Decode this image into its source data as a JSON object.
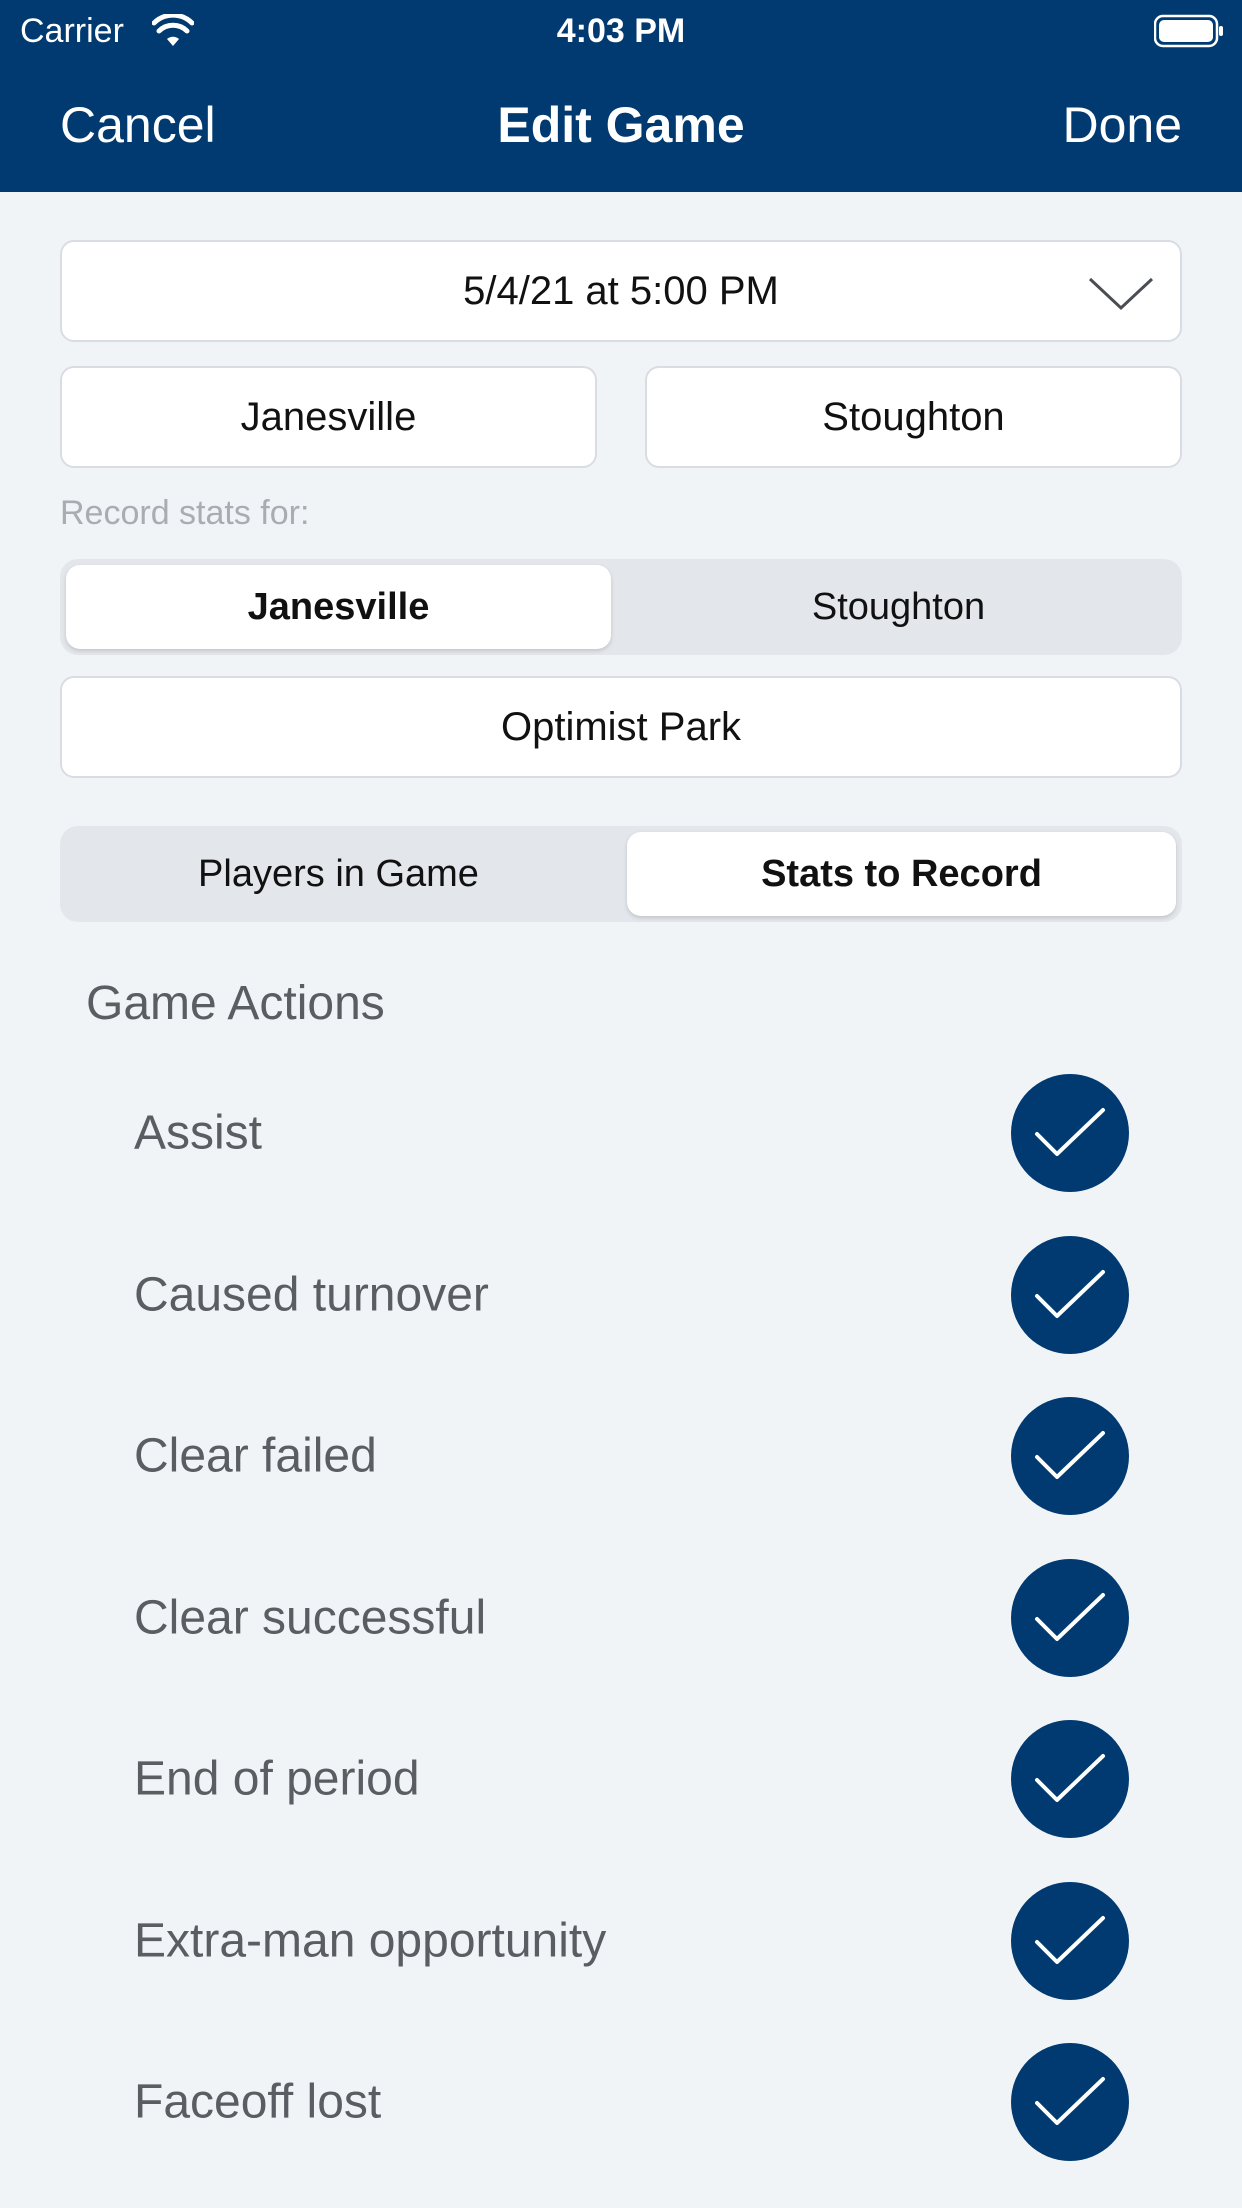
{
  "status_bar": {
    "carrier": "Carrier",
    "time": "4:03 PM"
  },
  "nav": {
    "cancel": "Cancel",
    "title": "Edit Game",
    "done": "Done"
  },
  "date_picker": {
    "value": "5/4/21 at 5:00 PM"
  },
  "teams": {
    "home": "Janesville",
    "away": "Stoughton"
  },
  "record_stats": {
    "label": "Record stats for:",
    "options": [
      "Janesville",
      "Stoughton"
    ],
    "selected": "Janesville"
  },
  "location": {
    "value": "Optimist Park"
  },
  "view_tabs": {
    "options": [
      "Players in Game",
      "Stats to Record"
    ],
    "selected": "Stats to Record"
  },
  "game_actions": {
    "title": "Game Actions",
    "items": [
      {
        "label": "Assist",
        "checked": true
      },
      {
        "label": "Caused turnover",
        "checked": true
      },
      {
        "label": "Clear failed",
        "checked": true
      },
      {
        "label": "Clear successful",
        "checked": true
      },
      {
        "label": "End of period",
        "checked": true
      },
      {
        "label": "Extra-man opportunity",
        "checked": true
      },
      {
        "label": "Faceoff lost",
        "checked": true
      }
    ]
  },
  "colors": {
    "brand": "#003a70",
    "background": "#f1f4f7",
    "secondary_text": "#5a5d62"
  }
}
